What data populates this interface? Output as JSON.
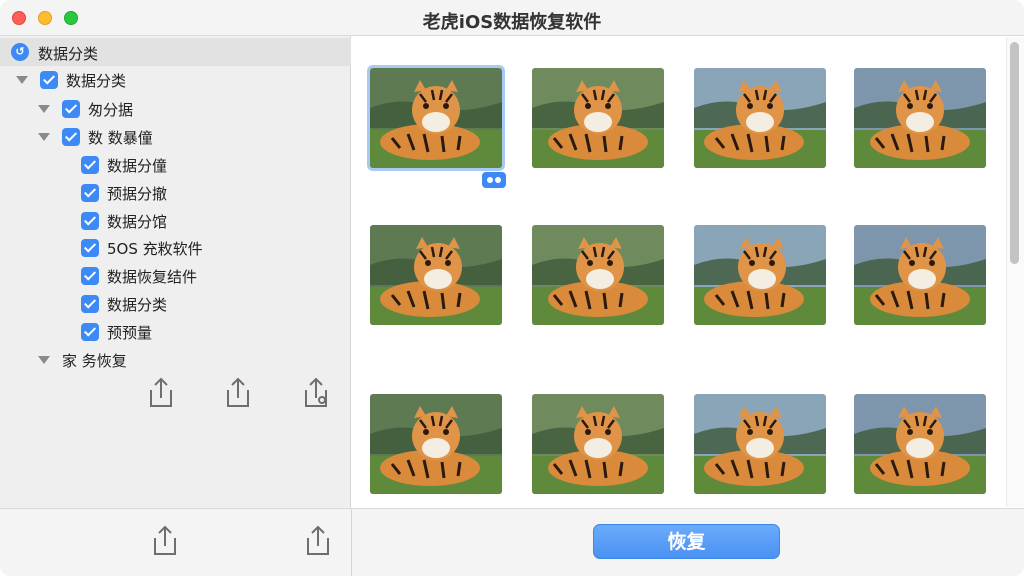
{
  "window": {
    "title": "老虎iOS数据恢复软件"
  },
  "sidebar": {
    "header_label": "数据分类",
    "tree": [
      {
        "label": "数据分类",
        "checked": true,
        "expanded": true
      },
      {
        "label": "匆分据",
        "checked": true,
        "expanded": true
      },
      {
        "label": "数 数暴僮",
        "checked": true,
        "expanded": true
      },
      {
        "label": "数据分僮",
        "checked": true
      },
      {
        "label": "预据分撤",
        "checked": true
      },
      {
        "label": "数据分馆",
        "checked": true
      },
      {
        "label": "5OS 充敉软件",
        "checked": true
      },
      {
        "label": "数据恢复结件",
        "checked": true
      },
      {
        "label": "数据分类",
        "checked": true
      },
      {
        "label": "预预量",
        "checked": true
      },
      {
        "label": "家 务恢复",
        "checked": false,
        "expanded": true
      }
    ]
  },
  "actions": {
    "restore_label": "恢复"
  },
  "grid": {
    "selected_index": 0,
    "columns": 4,
    "rows": 3
  },
  "colors": {
    "accent": "#3d8af7",
    "restore_button": "#5a9ff5"
  }
}
